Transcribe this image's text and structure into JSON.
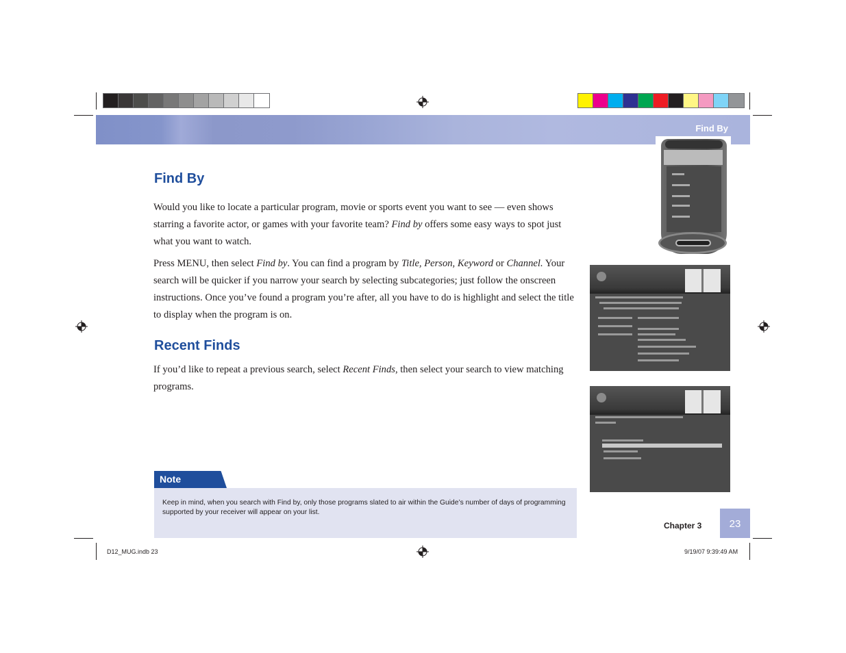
{
  "header": {
    "running_title": "Find By"
  },
  "color_bars": {
    "grayscale": [
      "#231f20",
      "#3a3737",
      "#4d4d4b",
      "#636363",
      "#787878",
      "#8e8e8e",
      "#a3a3a3",
      "#b9b9b9",
      "#d0d0d0",
      "#e8e8e8",
      "#ffffff"
    ],
    "process": [
      "#fff200",
      "#ec008c",
      "#00aeef",
      "#2e3192",
      "#00a651",
      "#ed1c24",
      "#231f20",
      "#fff685",
      "#f49ac1",
      "#7fd4f7",
      "#939598"
    ]
  },
  "sections": [
    {
      "heading": "Find By",
      "paragraphs": [
        {
          "parts": [
            {
              "text": "Would you like to locate a particular program, movie or sports event you want to see — even shows starring a favorite actor, or games with your favorite team? "
            },
            {
              "text": "Find by",
              "italic": true
            },
            {
              "text": " offers some easy ways to spot just what you want to watch."
            }
          ]
        },
        {
          "parts": [
            {
              "text": "Press MENU, then select "
            },
            {
              "text": "Find by",
              "italic": true
            },
            {
              "text": ". You can find a program by "
            },
            {
              "text": "Title, Person, Keyword",
              "italic": true
            },
            {
              "text": " or "
            },
            {
              "text": "Channel.",
              "italic": true
            },
            {
              "text": " Your search will be quicker if you narrow your search by selecting subcategories; just follow the onscreen instructions. Once you’ve found a program you’re after, all you have to do is highlight and select the title to display when the program is on."
            }
          ]
        }
      ]
    },
    {
      "heading": "Recent Finds",
      "paragraphs": [
        {
          "parts": [
            {
              "text": "If you’d like to repeat a previous search, select "
            },
            {
              "text": "Recent Finds",
              "italic": true
            },
            {
              "text": ", then select your search to view matching programs."
            }
          ]
        }
      ]
    }
  ],
  "note": {
    "label": "Note",
    "text": "Keep in mind, when you search with Find by, only those programs slated to air within the Guide’s number of days of programming supported by your receiver will appear on your list."
  },
  "footer": {
    "chapter": "Chapter 3",
    "page_number": "23",
    "slug_left": "D12_MUG.indb   23",
    "slug_right": "9/19/07   9:39:49 AM"
  },
  "images": {
    "remote": "remote-control-find-by-menu",
    "screen1": "find-by-search-screen",
    "screen2": "recent-finds-screen"
  }
}
